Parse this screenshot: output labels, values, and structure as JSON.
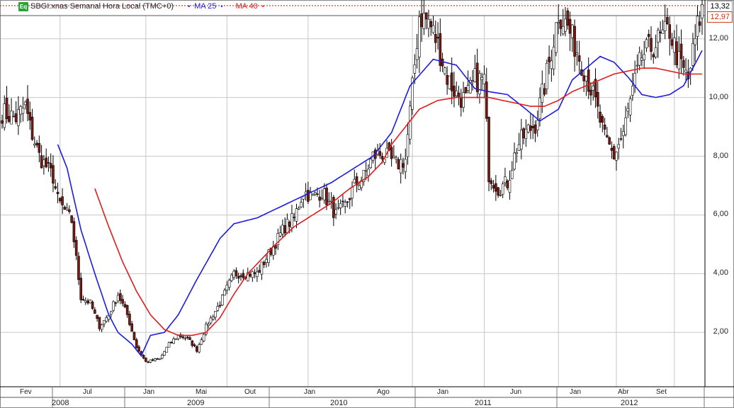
{
  "header": {
    "icon_label": "Eq",
    "title": "SBGI:xnas Semanal Hora Local (TMC+0)",
    "ma25_label": "MA 25",
    "ma40_label": "MA 40",
    "price_top": "13,32",
    "price_last": "12,97"
  },
  "colors": {
    "ma25": "#1c1ce0",
    "ma40": "#e01c1c",
    "bull": "#ffffff",
    "bear": "#7a1a14",
    "grid": "#c8c8c8",
    "eq_icon": "#2aa336"
  },
  "chart_data": {
    "type": "candlestick",
    "y_axis": {
      "ticks": [
        "2,00",
        "4,00",
        "6,00",
        "8,00",
        "10,00",
        "12,00"
      ],
      "tick_values": [
        2,
        4,
        6,
        8,
        10,
        12
      ],
      "range": [
        0.15,
        13.32
      ]
    },
    "x_axis": {
      "months": [
        "Fev",
        "Jul",
        "Jan",
        "Mai",
        "Out",
        "Jan",
        "Ago",
        "Jan",
        "Jun",
        "Jan",
        "Abr",
        "Set"
      ],
      "years": [
        "2008",
        "2009",
        "2010",
        "2011",
        "2012"
      ]
    },
    "close_anchors": [
      [
        0,
        9.5
      ],
      [
        6,
        9.3
      ],
      [
        10,
        9.7
      ],
      [
        12,
        9.0
      ],
      [
        16,
        8.0
      ],
      [
        22,
        7.3
      ],
      [
        24,
        6.5
      ],
      [
        30,
        5.8
      ],
      [
        34,
        3.2
      ],
      [
        38,
        3.0
      ],
      [
        42,
        2.2
      ],
      [
        46,
        2.6
      ],
      [
        50,
        3.3
      ],
      [
        54,
        2.6
      ],
      [
        58,
        1.5
      ],
      [
        62,
        1.0
      ],
      [
        68,
        1.1
      ],
      [
        72,
        1.6
      ],
      [
        76,
        1.9
      ],
      [
        80,
        1.8
      ],
      [
        84,
        1.4
      ],
      [
        88,
        2.2
      ],
      [
        94,
        3.0
      ],
      [
        100,
        4.0
      ],
      [
        106,
        4.0
      ],
      [
        110,
        4.0
      ],
      [
        116,
        4.8
      ],
      [
        122,
        5.6
      ],
      [
        126,
        5.9
      ],
      [
        130,
        6.8
      ],
      [
        134,
        6.6
      ],
      [
        138,
        6.8
      ],
      [
        144,
        6.0
      ],
      [
        148,
        6.3
      ],
      [
        152,
        7.0
      ],
      [
        156,
        7.3
      ],
      [
        160,
        8.0
      ],
      [
        164,
        8.1
      ],
      [
        170,
        7.7
      ],
      [
        174,
        7.9
      ],
      [
        177,
        10.3
      ],
      [
        180,
        12.8
      ],
      [
        184,
        12.6
      ],
      [
        188,
        11.8
      ],
      [
        192,
        10.7
      ],
      [
        196,
        10.1
      ],
      [
        200,
        9.9
      ],
      [
        204,
        10.6
      ],
      [
        208,
        10.6
      ],
      [
        210,
        7.4
      ],
      [
        214,
        6.9
      ],
      [
        218,
        7.1
      ],
      [
        222,
        8.3
      ],
      [
        226,
        8.8
      ],
      [
        230,
        9.1
      ],
      [
        234,
        10.4
      ],
      [
        238,
        12.0
      ],
      [
        240,
        12.9
      ],
      [
        244,
        12.4
      ],
      [
        248,
        11.6
      ],
      [
        252,
        10.8
      ],
      [
        256,
        9.8
      ],
      [
        260,
        8.6
      ],
      [
        264,
        8.0
      ],
      [
        268,
        8.8
      ],
      [
        272,
        10.2
      ],
      [
        276,
        11.4
      ],
      [
        280,
        11.7
      ],
      [
        284,
        12.0
      ],
      [
        288,
        12.3
      ],
      [
        292,
        11.2
      ],
      [
        296,
        10.6
      ],
      [
        298,
        11.5
      ],
      [
        300,
        12.4
      ],
      [
        302,
        12.97
      ]
    ],
    "ma25_anchors": [
      [
        24,
        8.4
      ],
      [
        28,
        7.6
      ],
      [
        34,
        5.5
      ],
      [
        40,
        4.0
      ],
      [
        46,
        2.6
      ],
      [
        50,
        2.0
      ],
      [
        56,
        1.6
      ],
      [
        60,
        1.2
      ],
      [
        64,
        1.9
      ],
      [
        70,
        2.0
      ],
      [
        76,
        2.6
      ],
      [
        84,
        3.8
      ],
      [
        94,
        5.2
      ],
      [
        100,
        5.7
      ],
      [
        110,
        5.9
      ],
      [
        118,
        6.2
      ],
      [
        126,
        6.5
      ],
      [
        134,
        6.8
      ],
      [
        142,
        7.1
      ],
      [
        152,
        7.6
      ],
      [
        160,
        8.0
      ],
      [
        168,
        8.8
      ],
      [
        176,
        10.4
      ],
      [
        186,
        11.3
      ],
      [
        196,
        11.1
      ],
      [
        204,
        10.3
      ],
      [
        210,
        10.2
      ],
      [
        218,
        10.1
      ],
      [
        226,
        9.6
      ],
      [
        232,
        9.2
      ],
      [
        240,
        9.6
      ],
      [
        246,
        10.6
      ],
      [
        252,
        11.0
      ],
      [
        258,
        11.4
      ],
      [
        264,
        11.2
      ],
      [
        270,
        10.7
      ],
      [
        276,
        10.1
      ],
      [
        282,
        10.0
      ],
      [
        288,
        10.1
      ],
      [
        294,
        10.4
      ],
      [
        302,
        11.6
      ]
    ],
    "ma40_anchors": [
      [
        40,
        6.9
      ],
      [
        46,
        5.6
      ],
      [
        52,
        4.4
      ],
      [
        58,
        3.4
      ],
      [
        64,
        2.6
      ],
      [
        70,
        2.1
      ],
      [
        76,
        1.9
      ],
      [
        82,
        1.9
      ],
      [
        88,
        2.0
      ],
      [
        94,
        2.5
      ],
      [
        100,
        3.3
      ],
      [
        106,
        4.0
      ],
      [
        112,
        4.5
      ],
      [
        118,
        5.0
      ],
      [
        126,
        5.6
      ],
      [
        134,
        6.0
      ],
      [
        142,
        6.4
      ],
      [
        150,
        6.9
      ],
      [
        158,
        7.3
      ],
      [
        164,
        7.8
      ],
      [
        168,
        8.4
      ],
      [
        174,
        9.0
      ],
      [
        180,
        9.6
      ],
      [
        188,
        9.9
      ],
      [
        196,
        10.0
      ],
      [
        204,
        10.0
      ],
      [
        210,
        10.0
      ],
      [
        216,
        9.9
      ],
      [
        222,
        9.8
      ],
      [
        228,
        9.7
      ],
      [
        234,
        9.7
      ],
      [
        240,
        9.9
      ],
      [
        246,
        10.2
      ],
      [
        252,
        10.4
      ],
      [
        258,
        10.6
      ],
      [
        264,
        10.8
      ],
      [
        270,
        10.9
      ],
      [
        276,
        11.0
      ],
      [
        282,
        11.0
      ],
      [
        288,
        10.9
      ],
      [
        294,
        10.8
      ],
      [
        302,
        10.8
      ]
    ]
  }
}
